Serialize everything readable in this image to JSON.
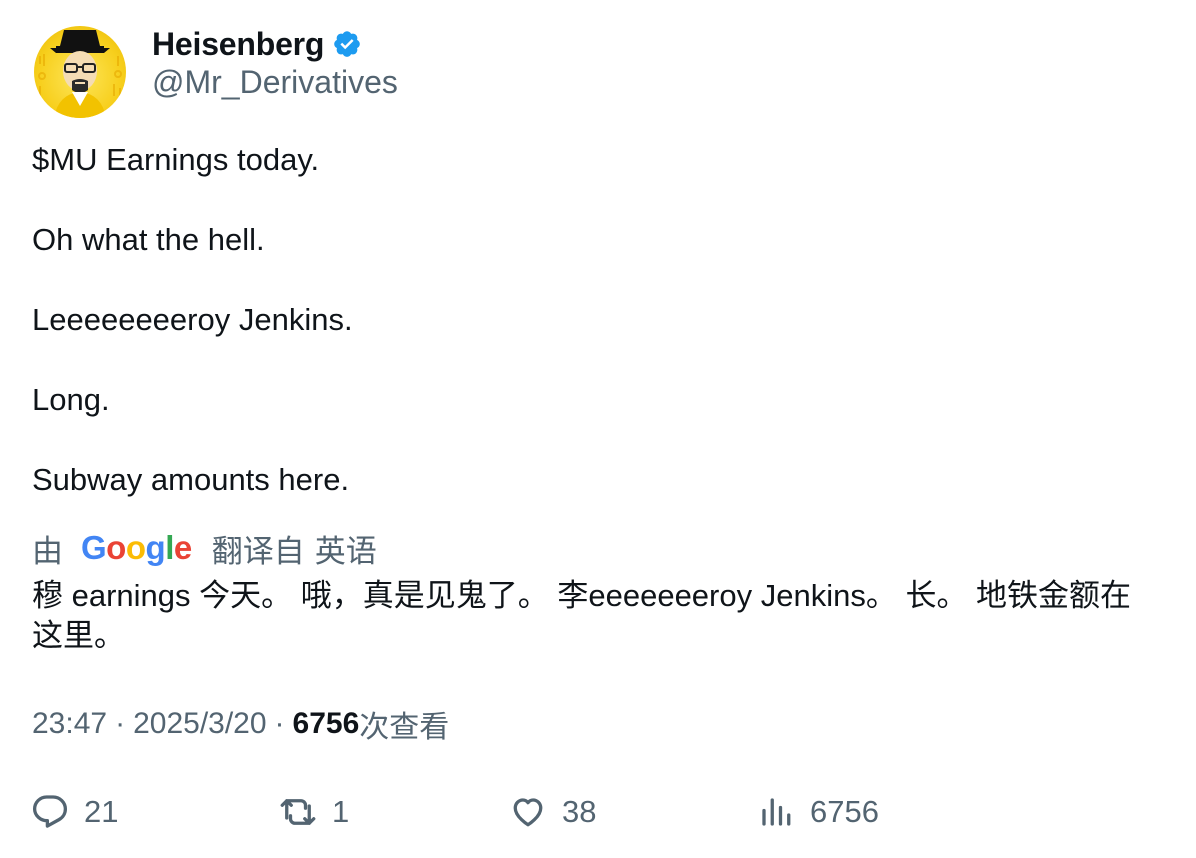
{
  "author": {
    "name": "Heisenberg",
    "handle": "@Mr_Derivatives",
    "verified": true,
    "verified_color": "#1d9bf0",
    "avatar_icon": "heisenberg-portrait-avatar"
  },
  "tweet": {
    "paragraphs": [
      "$MU Earnings today.",
      "Oh what the hell.",
      "Leeeeeeeeroy Jenkins.",
      "Long.",
      "Subway amounts here."
    ]
  },
  "translation": {
    "prefix": "由",
    "provider_logo": [
      "G",
      "o",
      "o",
      "g",
      "l",
      "e"
    ],
    "from_label": "翻译自",
    "language": "英语",
    "text": "穆 earnings 今天。 哦，真是见鬼了。 李eeeeeeeroy Jenkins。 长。 地铁金额在这里。"
  },
  "meta": {
    "time": "23:47",
    "separator": "·",
    "date": "2025/3/20",
    "views_count": "6756",
    "views_label": "次查看"
  },
  "actions": {
    "reply": {
      "icon": "reply-icon",
      "count": "21"
    },
    "retweet": {
      "icon": "retweet-icon",
      "count": "1"
    },
    "like": {
      "icon": "heart-icon",
      "count": "38"
    },
    "views": {
      "icon": "analytics-icon",
      "count": "6756"
    }
  },
  "colors": {
    "text": "#0f1419",
    "secondary": "#536471",
    "google_blue": "#4285F4",
    "google_red": "#EA4335",
    "google_yellow": "#FBBC05",
    "google_green": "#34A853"
  }
}
